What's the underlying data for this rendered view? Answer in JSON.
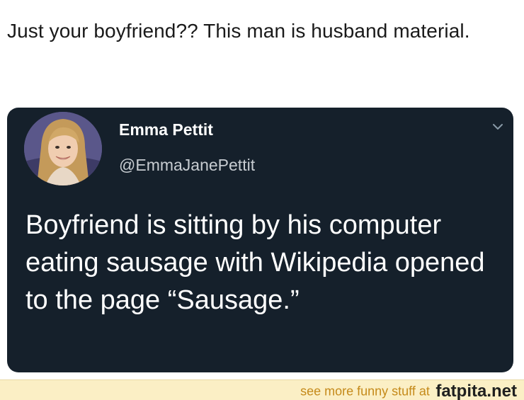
{
  "caption": "Just your boyfriend?? This man is husband material.",
  "tweet": {
    "display_name": "Emma Pettit",
    "handle": "@EmmaJanePettit",
    "text": "Boyfriend is sitting by his computer eating sausage with Wikipedia opened to the page “Sausage.”"
  },
  "footer": {
    "tagline": "see more funny stuff at",
    "brand": "fatpita.net"
  },
  "icons": {
    "menu": "chevron-down-icon",
    "avatar": "profile-photo"
  },
  "colors": {
    "card_background": "#15202b",
    "footer_background": "#fbefc5",
    "footer_accent": "#c58a1a"
  }
}
